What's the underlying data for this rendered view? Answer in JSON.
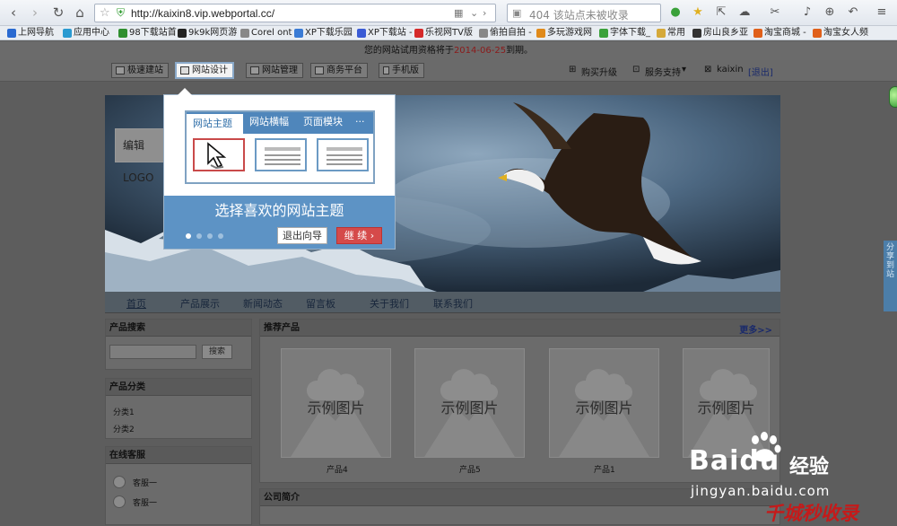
{
  "browser": {
    "url": "http://kaixin8.vip.webportal.cc/",
    "search_placeholder": "404 该站点未被收录"
  },
  "bookmarks": [
    {
      "label": "上网导航",
      "color": "#2a6ad1"
    },
    {
      "label": "应用中心",
      "color": "#2a9ad1"
    },
    {
      "label": "98下载站首",
      "color": "#2f8f2f"
    },
    {
      "label": "9k9k网页游",
      "color": "#222222"
    },
    {
      "label": "Corel ont",
      "color": "#888888"
    },
    {
      "label": "XP下载乐园",
      "color": "#3a7bd5"
    },
    {
      "label": "XP下载站 -",
      "color": "#3a5bd5"
    },
    {
      "label": "乐视网TV版",
      "color": "#d52a2a"
    },
    {
      "label": "偷拍自拍 -",
      "color": "#888888"
    },
    {
      "label": "多玩游戏网",
      "color": "#e08a1a"
    },
    {
      "label": "字体下载_",
      "color": "#3aa13a"
    },
    {
      "label": "常用",
      "color": "#d5a93a"
    },
    {
      "label": "房山良乡亚",
      "color": "#333333"
    },
    {
      "label": "淘宝商城 -",
      "color": "#e0601a"
    },
    {
      "label": "淘宝女人频",
      "color": "#e0601a"
    }
  ],
  "notice": {
    "prefix": "您的网站试用资格将于",
    "date": "2014-06-25",
    "suffix": "到期。"
  },
  "admin": {
    "buttons": [
      "极速建站",
      "网站设计",
      "网站管理",
      "商务平台",
      "手机版"
    ],
    "active": "网站设计",
    "buy": "购买升级",
    "service": "服务支持",
    "user": "kaixin",
    "logout": "[退出]"
  },
  "site": {
    "logo_edit": "编辑LOGO",
    "nav": [
      "首页",
      "产品展示",
      "新闻动态",
      "留言板",
      "关于我们",
      "联系我们"
    ],
    "product_search": {
      "title": "产品搜索",
      "button": "搜索"
    },
    "categories": {
      "title": "产品分类",
      "items": [
        "分类1",
        "分类2"
      ]
    },
    "service": {
      "title": "在线客服",
      "items": [
        "客服一",
        "客服一"
      ]
    },
    "recommended": {
      "title": "推荐产品",
      "more": "更多>>",
      "products": [
        {
          "image_label": "示例图片",
          "name": "产品4"
        },
        {
          "image_label": "示例图片",
          "name": "产品5"
        },
        {
          "image_label": "示例图片",
          "name": "产品1"
        },
        {
          "image_label": "示例图片",
          "name": ""
        }
      ]
    },
    "company_intro": "公司简介"
  },
  "wizard": {
    "tabs": [
      "网站主题",
      "网站横幅",
      "页面模块",
      "···"
    ],
    "title": "选择喜欢的网站主题",
    "exit": "退出向导",
    "continue": "继 续 ›",
    "dots": 4,
    "current_dot": 1
  },
  "share_tab": "分享到站",
  "watermark": {
    "brand": "Bai",
    "brand2": "du",
    "suffix": "经验",
    "url": "jingyan.baidu.com",
    "slogan": "千城秒收录"
  }
}
